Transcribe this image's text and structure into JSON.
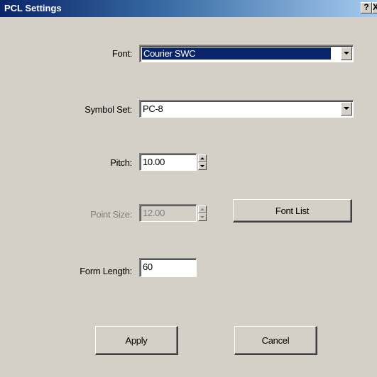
{
  "window": {
    "title": "PCL Settings",
    "help_label": "?",
    "close_label": "X"
  },
  "fields": {
    "font": {
      "label": "Font:",
      "value": "Courier SWC",
      "selected": true
    },
    "symbol_set": {
      "label": "Symbol Set:",
      "value": "PC-8"
    },
    "pitch": {
      "label": "Pitch:",
      "value": "10.00"
    },
    "point_size": {
      "label": "Point Size:",
      "value": "12.00",
      "disabled": true
    },
    "form_length": {
      "label": "Form Length:",
      "value": "60"
    }
  },
  "buttons": {
    "font_list": "Font List",
    "apply": "Apply",
    "cancel": "Cancel"
  },
  "colors": {
    "dialog_bg": "#d4d0c8",
    "titlebar_start": "#0a246a",
    "titlebar_end": "#a6caf0",
    "selection": "#0a246a"
  }
}
